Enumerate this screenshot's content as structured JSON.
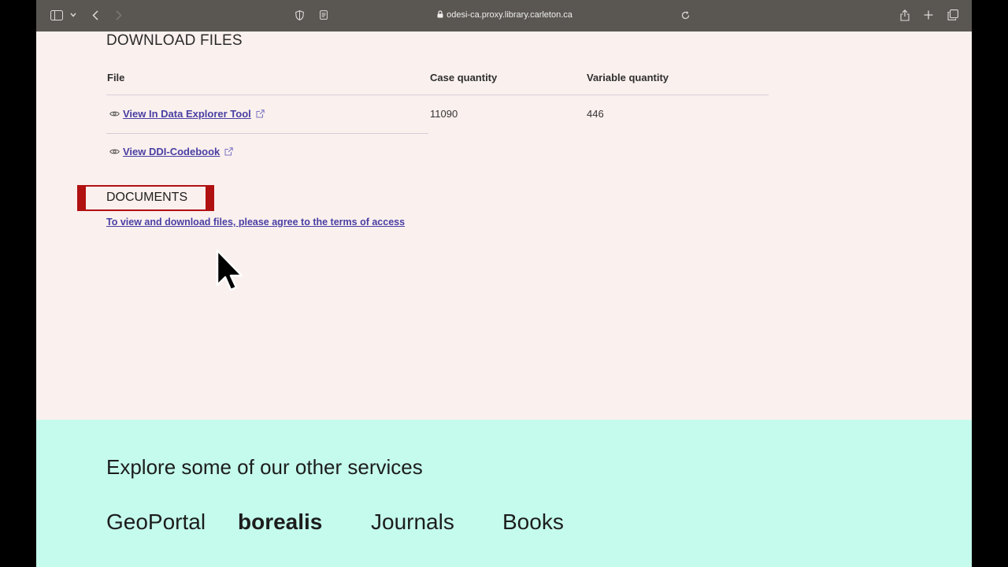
{
  "browser": {
    "url": "odesi-ca.proxy.library.carleton.ca",
    "icons": [
      "sidebar-icon",
      "chevron-down-icon",
      "back-icon",
      "forward-icon",
      "shield-icon",
      "reader-icon",
      "lock-icon",
      "reload-icon",
      "share-icon",
      "new-tab-icon",
      "tabs-overview-icon"
    ]
  },
  "download_files": {
    "heading": "DOWNLOAD FILES",
    "columns": [
      "File",
      "Case quantity",
      "Variable quantity"
    ],
    "rows": [
      {
        "link": "View In Data Explorer Tool",
        "case_quantity": "11090",
        "variable_quantity": "446"
      },
      {
        "link": "View DDI-Codebook"
      }
    ]
  },
  "documents": {
    "heading": "DOCUMENTS",
    "terms_link": "To view and download files, please agree to the terms of access"
  },
  "footer": {
    "title": "Explore some of our other services",
    "services": [
      "GeoPortal",
      "borealis",
      "Journals",
      "Books"
    ]
  },
  "colors": {
    "page_bg": "#faf0ee",
    "footer_bg": "#c4fbec",
    "link": "#4a3fa3",
    "highlight": "#b01111",
    "toolbar": "#5a5753"
  }
}
